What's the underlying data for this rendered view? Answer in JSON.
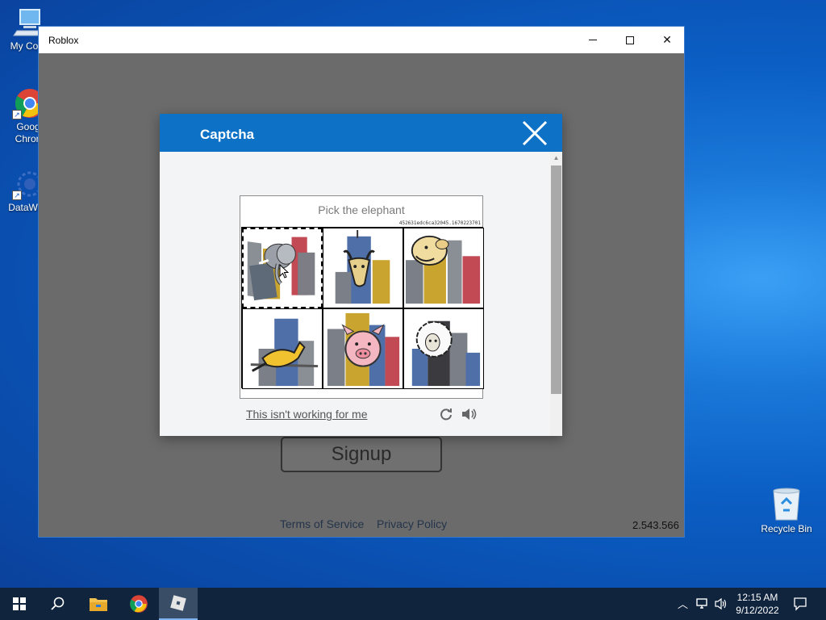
{
  "desktop": {
    "icons": [
      {
        "label": "My Com",
        "icon": "computer-icon"
      },
      {
        "label": "Goog Chron",
        "line1": "Goog",
        "line2": "Chron",
        "icon": "chrome-icon"
      },
      {
        "label": "DataWag",
        "icon": "datawagon-icon"
      },
      {
        "label": "Recycle Bin",
        "icon": "recycle-bin-icon"
      }
    ]
  },
  "window": {
    "title": "Roblox",
    "minimize_icon": "minimize-icon",
    "maximize_icon": "maximize-icon",
    "close_label": "✕"
  },
  "app": {
    "signup_label": "Signup",
    "terms_label": "Terms of Service",
    "privacy_label": "Privacy Policy",
    "version": "2.543.566"
  },
  "captcha": {
    "title": "Captcha",
    "prompt": "Pick the elephant",
    "hash": "452631edc6ca32045.1670223701",
    "tiles": [
      {
        "animal": "elephant",
        "selected": true
      },
      {
        "animal": "goat",
        "selected": false
      },
      {
        "animal": "camel",
        "selected": false
      },
      {
        "animal": "kangaroo",
        "selected": false
      },
      {
        "animal": "pig",
        "selected": false
      },
      {
        "animal": "sheep",
        "selected": false
      }
    ],
    "not_working_label": "This isn't working for me",
    "colors": {
      "header": "#0d72c6",
      "body": "#f3f4f5"
    }
  },
  "taskbar": {
    "items": [
      "start-icon",
      "search-icon",
      "file-explorer-icon",
      "chrome-icon",
      "roblox-icon"
    ],
    "active": "roblox-icon",
    "time": "12:15 AM",
    "date": "9/12/2022",
    "color": "#10243d"
  }
}
